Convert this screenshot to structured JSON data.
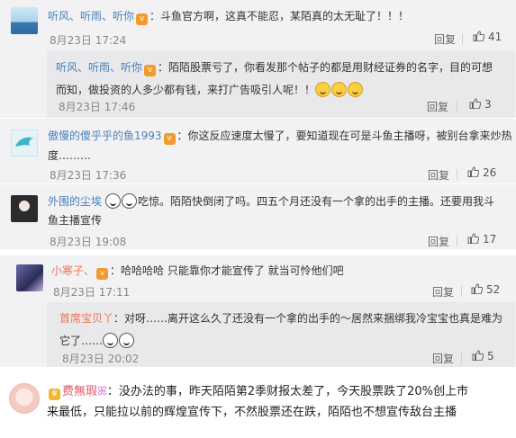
{
  "comments": [
    {
      "user": "听风、听雨、听你",
      "text": "：斗鱼官方啊，这真不能忍，某陌真的太无耻了！！！",
      "time": "8月23日 17:24",
      "reply_label": "回复",
      "likes": "41",
      "replies": [
        {
          "user": "听风、听雨、听你",
          "text_line1": "：陌陌股票亏了，你看发那个帖子的都是用财经证券的名字，目的可想",
          "text_line2": "而知，做投资的人多少都有钱，来打广告吸引人呢！！",
          "time": "8月23日 17:46",
          "reply_label": "回复",
          "likes": "3"
        }
      ]
    },
    {
      "user": "傲慢的傻乎乎的鱼1993",
      "text_line1": "：你这反应速度太慢了，要知道现在可是斗鱼主播呀，被别台拿来炒热",
      "text_line2": "度………",
      "time": "8月23日 17:36",
      "reply_label": "回复",
      "likes": "26"
    },
    {
      "user": "外围的尘埃",
      "text_line1": "吃惊。陌陌快倒闭了吗。四五个月还没有一个拿的出手的主播。还要用我斗",
      "text_line2": "鱼主播宣传",
      "time": "8月23日 19:08",
      "reply_label": "回复",
      "likes": "17"
    },
    {
      "user": "小寒子、",
      "text": "：哈哈哈哈 只能靠你才能宣传了 就当可怜他们吧",
      "time": "8月23日 17:11",
      "reply_label": "回复",
      "likes": "52",
      "replies": [
        {
          "user": "首席宝贝丫",
          "text_line1": "：对呀……离开这么久了还没有一个拿的出手的～居然来捆绑我冷宝宝也真是难为",
          "text_line2": "它了……",
          "time": "8月23日 20:02",
          "reply_label": "回复",
          "likes": "5"
        }
      ]
    }
  ],
  "bottom_post": {
    "user": "费無瑕",
    "line1": "：没办法的事，昨天陌陌第2季财报太差了，今天股票跌了20%创上市",
    "line2": "来最低，只能拉以前的辉煌宣传下，不然股票还在跌，陌陌也不想宣传敌台主播"
  }
}
